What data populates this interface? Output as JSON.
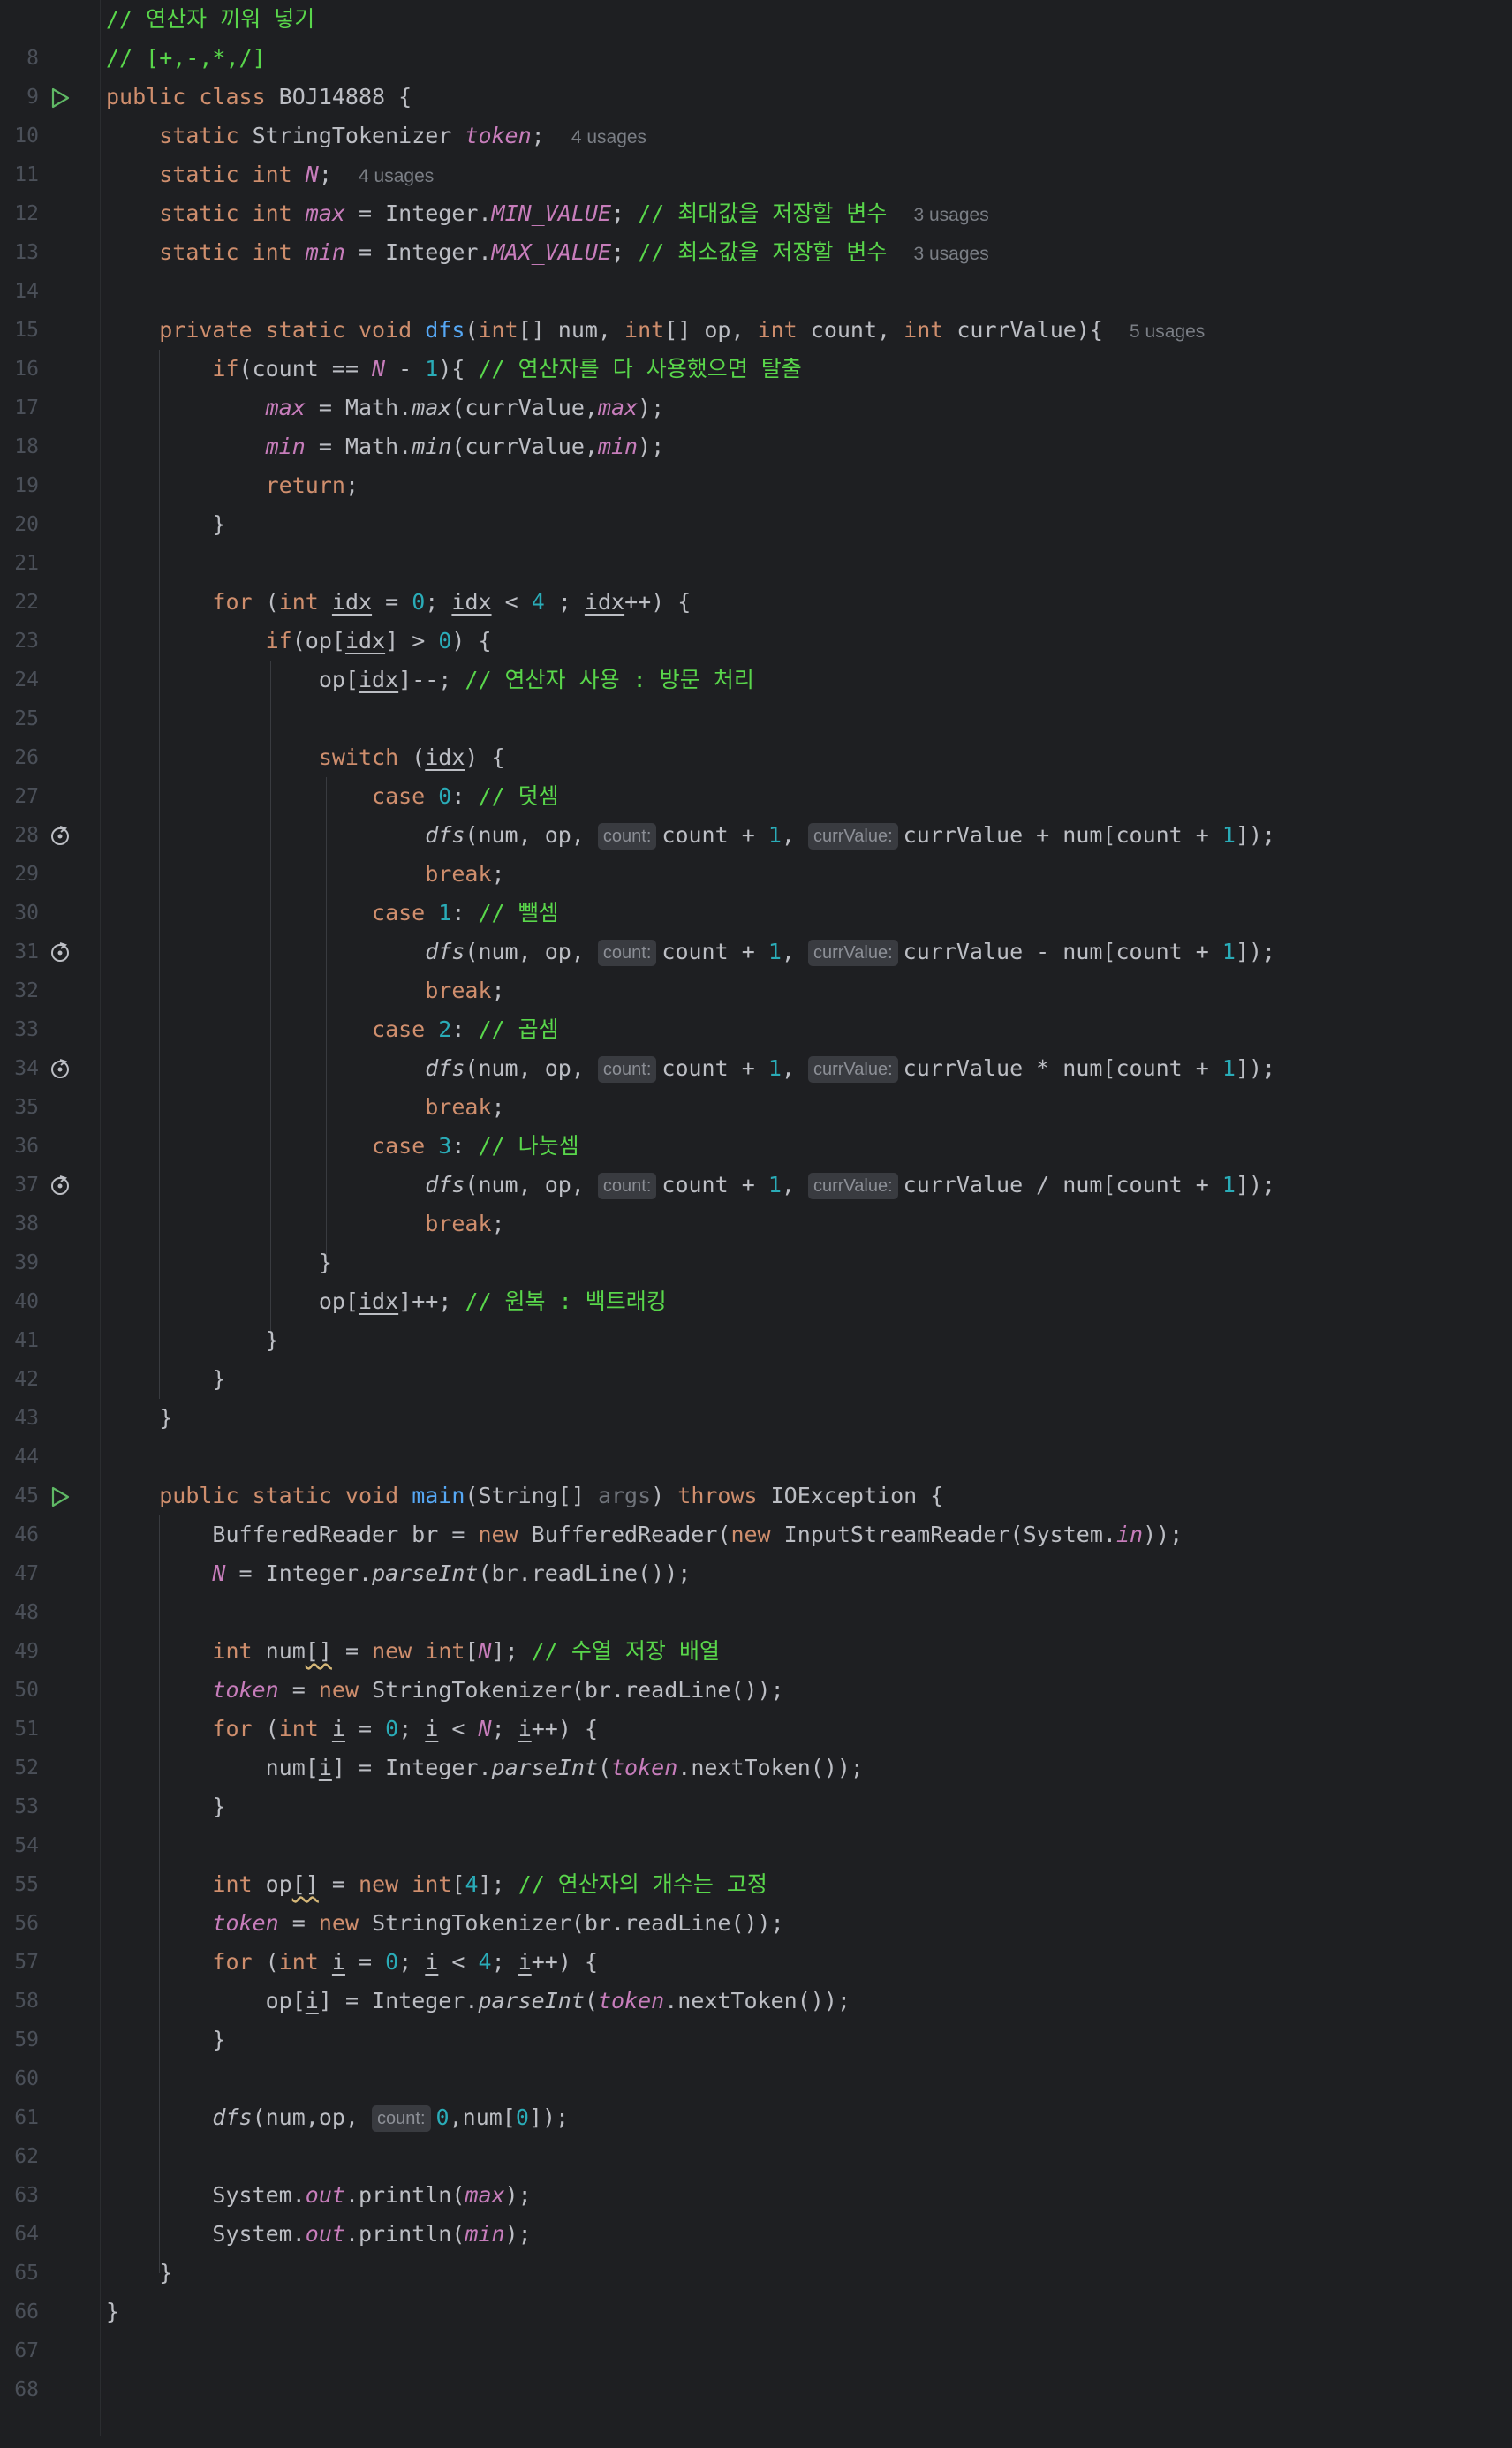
{
  "code": {
    "comment_insert_ops": "// 연산자 끼워 넣기",
    "comment_ops_list": "// [+,-,*,/]",
    "class_name": "BOJ14888",
    "usages": {
      "token": "4 usages",
      "N": "4 usages",
      "max": "3 usages",
      "min": "3 usages",
      "dfs": "5 usages"
    },
    "comments": {
      "max_store": "// 최대값을 저장할 변수",
      "min_store": "// 최소값을 저장할 변수",
      "all_used_exit": "// 연산자를 다 사용했으면 탈출",
      "use_op_visit": "// 연산자 사용 : 방문 처리",
      "add": "// 덧셈",
      "sub": "// 뺄셈",
      "mul": "// 곱셈",
      "div": "// 나눗셈",
      "restore_backtrack": "// 원복 : 백트래킹",
      "seq_array": "// 수열 저장 배열",
      "op_count_fixed": "// 연산자의 개수는 고정"
    },
    "inlay_hints": {
      "count": "count:",
      "currValue": "currValue:"
    }
  },
  "gutter": {
    "line_numbers": [
      "8",
      "9",
      "10",
      "11",
      "12",
      "13",
      "14",
      "15",
      "16",
      "17",
      "18",
      "19",
      "20",
      "21",
      "22",
      "23",
      "24",
      "25",
      "26",
      "27",
      "28",
      "29",
      "30",
      "31",
      "32",
      "33",
      "34",
      "35",
      "36",
      "37",
      "38",
      "39",
      "40",
      "41",
      "42",
      "43",
      "44",
      "45",
      "46",
      "47",
      "48",
      "49",
      "50",
      "51",
      "52",
      "53",
      "54",
      "55",
      "56",
      "57",
      "58",
      "59",
      "60",
      "61",
      "62",
      "63",
      "64",
      "65",
      "66",
      "67",
      "68"
    ],
    "icons": {
      "run": "run-gutter-icon",
      "recursion": "recursive-call-icon"
    }
  },
  "colors": {
    "background": "#1e1f22",
    "keyword": "#cf8e6d",
    "comment": "#59d64b",
    "number": "#2aacb8",
    "function": "#56a8f5",
    "static_field": "#c77dbb",
    "text": "#bcbec4"
  }
}
